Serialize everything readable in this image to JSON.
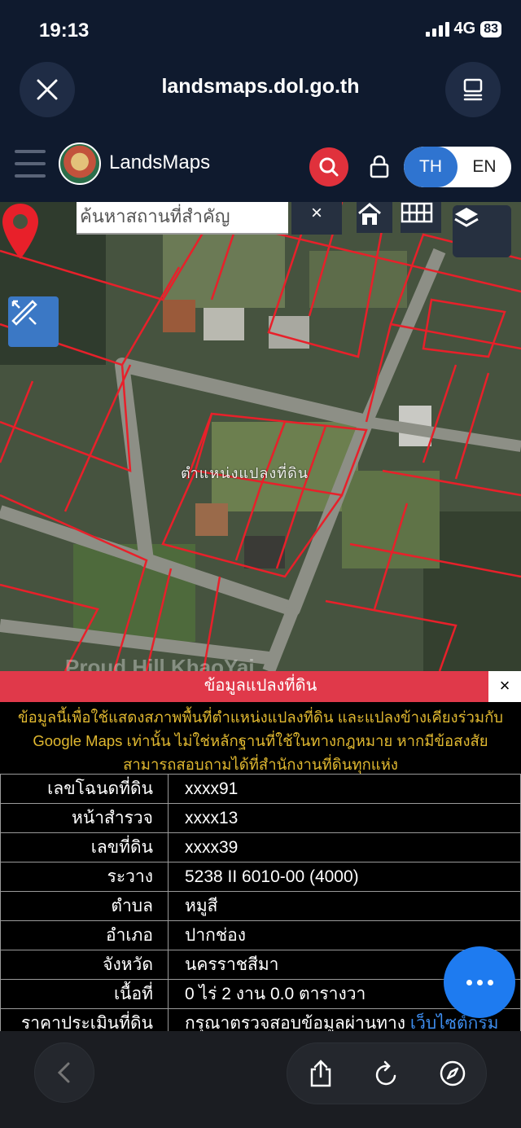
{
  "status_bar": {
    "time": "19:13",
    "network": "4G",
    "battery": "83"
  },
  "browser": {
    "url": "landsmaps.dol.go.th"
  },
  "app": {
    "title": "LandsMaps",
    "lang_th": "TH",
    "lang_en": "EN"
  },
  "map": {
    "search_placeholder": "ค้นหาสถานที่สำคัญ",
    "clear_label": "×",
    "parcel_label": "ตำแหน่งแปลงที่ดิน",
    "watermark": "Proud Hill KhaoYai"
  },
  "info": {
    "header": "ข้อมูลแปลงที่ดิน",
    "close_label": "×",
    "notice": "ข้อมูลนี้เพื่อใช้แสดงสภาพพื้นที่ตำแหน่งแปลงที่ดิน และแปลงข้างเคียงร่วมกับ Google Maps เท่านั้น ไม่ใช่หลักฐานที่ใช้ในทางกฎหมาย หากมีข้อสงสัยสามารถสอบถามได้ที่สำนักงานที่ดินทุกแห่ง",
    "rows": [
      {
        "label": "เลขโฉนดที่ดิน",
        "value": "xxxx91"
      },
      {
        "label": "หน้าสำรวจ",
        "value": "xxxx13"
      },
      {
        "label": "เลขที่ดิน",
        "value": "xxxx39"
      },
      {
        "label": "ระวาง",
        "value": "5238 II 6010-00 (4000)"
      },
      {
        "label": "ตำบล",
        "value": "หมูสี"
      },
      {
        "label": "อำเภอ",
        "value": "ปากช่อง"
      },
      {
        "label": "จังหวัด",
        "value": "นครราชสีมา"
      },
      {
        "label": "เนื้อที่",
        "value": "0 ไร่ 2 งาน 0.0 ตารางวา"
      },
      {
        "label": "ราคาประเมินที่ดิน",
        "value": "กรุณาตรวจสอบข้อมูลผ่านทาง",
        "link": "เว็บไซต์กรม"
      }
    ]
  },
  "icons": {
    "close": "close-icon",
    "tabs": "tabs-icon",
    "menu": "menu-icon",
    "search": "search-icon",
    "lock": "lock-icon",
    "home": "home-icon",
    "grid": "grid-icon",
    "layers": "layers-icon",
    "ruler": "ruler-icon",
    "pin": "map-pin-icon",
    "more": "more-icon",
    "back": "back-icon",
    "share": "share-icon",
    "reload": "reload-icon",
    "compass": "compass-icon"
  },
  "colors": {
    "accent_red": "#e0394a",
    "accent_blue": "#2f74d0",
    "notice_yellow": "#e0b830"
  }
}
